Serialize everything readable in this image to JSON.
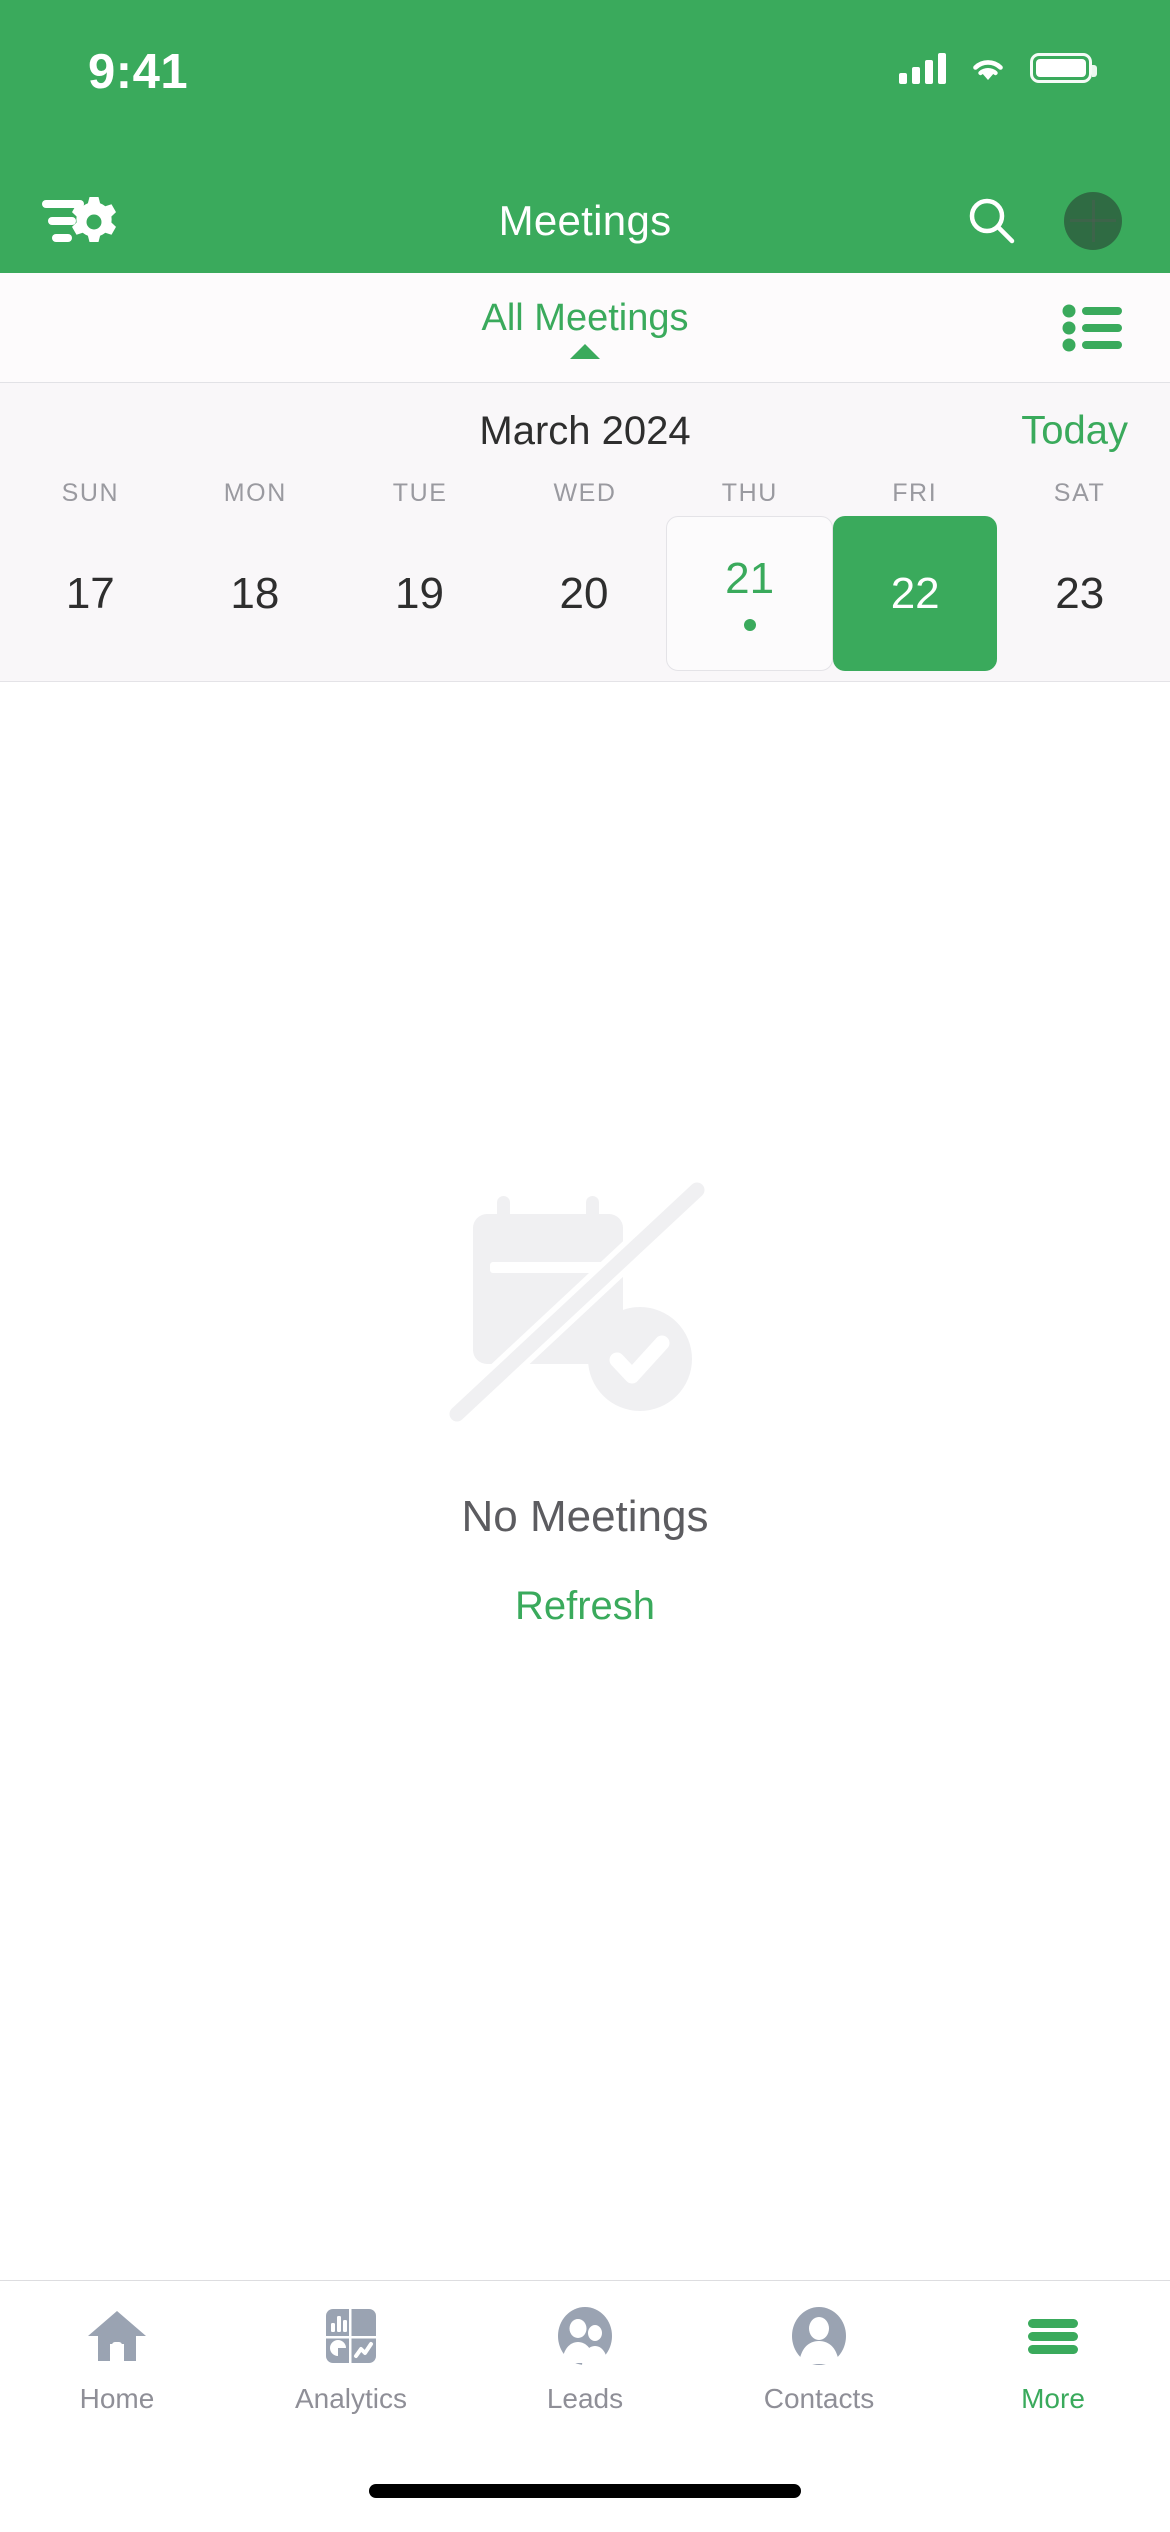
{
  "theme": {
    "brand_green": "#3AAA5C",
    "header_text": "#FFFFFF",
    "muted_text": "#8F8F97",
    "calendar_bg": "#F9F7F9"
  },
  "status_bar": {
    "time": "9:41",
    "cellular_icon": "cellular-signal-icon",
    "wifi_icon": "wifi-icon",
    "battery_icon": "battery-full-icon"
  },
  "nav_bar": {
    "title": "Meetings",
    "left_icon": "filter-settings-icon",
    "search_icon": "search-icon",
    "avatar_icon": "user-avatar"
  },
  "filter_bar": {
    "label": "All Meetings",
    "caret_icon": "caret-up-icon",
    "list_view_icon": "list-view-icon"
  },
  "calendar": {
    "month_label": "March 2024",
    "today_label": "Today",
    "weekdays": [
      "SUN",
      "MON",
      "TUE",
      "WED",
      "THU",
      "FRI",
      "SAT"
    ],
    "days": [
      {
        "number": "17",
        "is_today": false,
        "is_selected": false,
        "has_event": false
      },
      {
        "number": "18",
        "is_today": false,
        "is_selected": false,
        "has_event": false
      },
      {
        "number": "19",
        "is_today": false,
        "is_selected": false,
        "has_event": false
      },
      {
        "number": "20",
        "is_today": false,
        "is_selected": false,
        "has_event": false
      },
      {
        "number": "21",
        "is_today": true,
        "is_selected": false,
        "has_event": true
      },
      {
        "number": "22",
        "is_today": false,
        "is_selected": true,
        "has_event": false
      },
      {
        "number": "23",
        "is_today": false,
        "is_selected": false,
        "has_event": false
      }
    ]
  },
  "empty_state": {
    "illustration_icon": "no-meetings-calendar-slash-icon",
    "title": "No Meetings",
    "action_label": "Refresh"
  },
  "tab_bar": {
    "tabs": [
      {
        "label": "Home",
        "icon": "home-icon",
        "active": false
      },
      {
        "label": "Analytics",
        "icon": "analytics-icon",
        "active": false
      },
      {
        "label": "Leads",
        "icon": "leads-icon",
        "active": false
      },
      {
        "label": "Contacts",
        "icon": "contacts-icon",
        "active": false
      },
      {
        "label": "More",
        "icon": "hamburger-more-icon",
        "active": true
      }
    ]
  },
  "home_indicator": {
    "icon": "home-indicator-bar"
  }
}
